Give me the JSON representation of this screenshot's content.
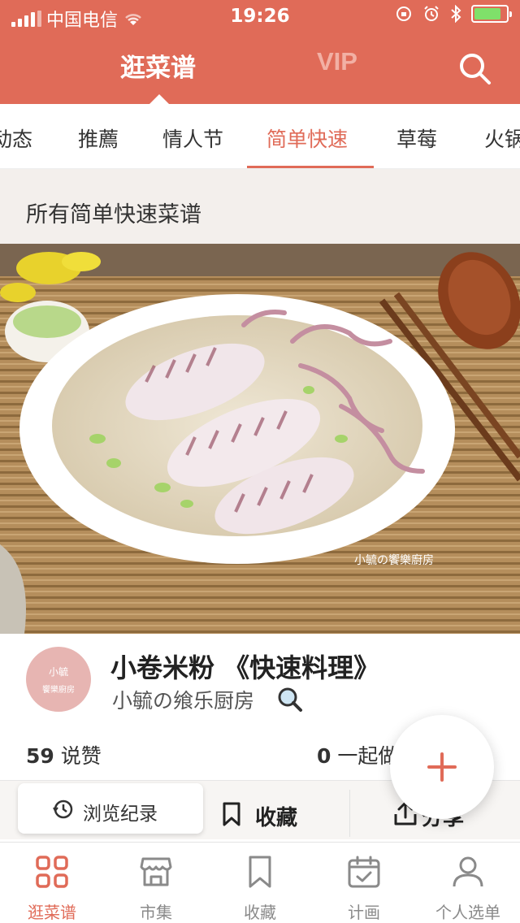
{
  "status_bar": {
    "carrier": "中国电信",
    "time": "19:26"
  },
  "top_nav": {
    "active_title": "逛菜谱",
    "vip_title": "VIP"
  },
  "category_tabs": [
    "动态",
    "推薦",
    "情人节",
    "简单快速",
    "草莓",
    "火锅"
  ],
  "category_active": "简单快速",
  "section": {
    "title": "所有简单快速菜谱"
  },
  "recipe": {
    "title": "小卷米粉 《快速料理》",
    "author": "小毓の飨乐厨房",
    "avatar_text_1": "小毓",
    "avatar_text_2": "饗樂廚房",
    "photo_watermark": "小毓の饗樂廚房",
    "likes_count": "59",
    "likes_label": "说赞",
    "together_count": "0",
    "together_label": "一起做"
  },
  "actions": {
    "history": "浏览纪录",
    "collect": "收藏",
    "share": "分享"
  },
  "tab_bar": {
    "items": [
      {
        "label": "逛菜谱",
        "icon": "grid-icon"
      },
      {
        "label": "市集",
        "icon": "store-icon"
      },
      {
        "label": "收藏",
        "icon": "bookmark-icon"
      },
      {
        "label": "计画",
        "icon": "calendar-check-icon"
      },
      {
        "label": "个人选单",
        "icon": "person-icon"
      }
    ]
  },
  "colors": {
    "brand": "#e06b58",
    "header_bg": "#e06b58",
    "section_bg": "#f3efec",
    "inactive_gray": "#8a8a8a"
  }
}
